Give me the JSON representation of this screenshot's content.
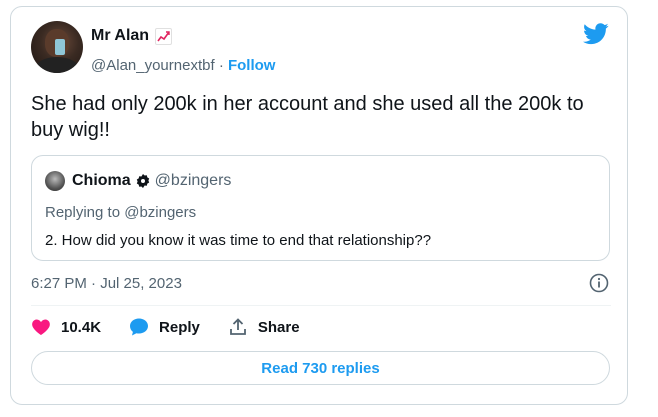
{
  "author": {
    "name": "Mr Alan",
    "name_emoji": "chart-increasing-icon",
    "handle": "@Alan_yournextbf",
    "separator": "·",
    "follow_label": "Follow"
  },
  "tweet": {
    "text": "She had only 200k in her account and she used all the 200k to buy wig!!",
    "timestamp": "6:27 PM · Jul 25, 2023"
  },
  "quoted": {
    "name": "Chioma",
    "handle": "@bzingers",
    "replying_to": "Replying to @bzingers",
    "text": "2. How did you know it was time to end that relationship??"
  },
  "actions": {
    "like_count": "10.4K",
    "reply_label": "Reply",
    "share_label": "Share"
  },
  "read_replies_label": "Read 730 replies",
  "colors": {
    "brand": "#1d9bf0",
    "like": "#f91880",
    "secondary_text": "#536471",
    "border": "#cfd9de"
  }
}
